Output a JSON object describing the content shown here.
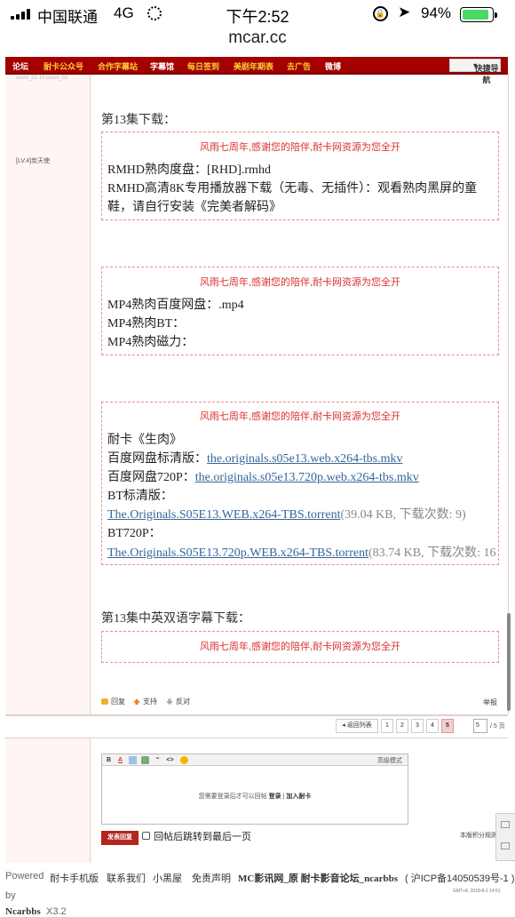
{
  "status_bar": {
    "carrier": "中国联通",
    "network": "4G",
    "time": "下午2:52",
    "battery": "94%"
  },
  "browser": {
    "url": "mcar.cc"
  },
  "topnav": {
    "items": [
      "论坛",
      "耐卡公众号",
      "合作字幕站",
      "字幕馆",
      "每日签到",
      "美剧年期表",
      "去广告",
      "微博"
    ],
    "quick_nav": "快捷导航"
  },
  "colors": {
    "nav_bg": "#a40000",
    "notice": "#dc3030",
    "link": "#336699",
    "accent_yellow": "#ffcc33"
  },
  "author": {
    "old_name": "ceshi_01.15.ceshi_02",
    "level": "[LV.4]炭天使"
  },
  "post": {
    "episode_heading": "第13集下载：",
    "notice": "风雨七周年,感谢您的陪伴,耐卡网资源为您全开",
    "rmhd": {
      "line1": "RMHD熟肉度盘：[RHD].rmhd",
      "line2": "RMHD高清8K专用播放器下载（无毒、无插件）：观看熟肉黑屏的童",
      "line3": "鞋，请自行安装《完美者解码》"
    },
    "mp4": {
      "line1": "MP4熟肉百度网盘：.mp4",
      "line2": "MP4熟肉BT：",
      "line3": "MP4熟肉磁力："
    },
    "raw": {
      "title": "耐卡《生肉》",
      "baidu_std_label": "百度网盘标清版：",
      "baidu_std_link": "the.originals.s05e13.web.x264-tbs.mkv",
      "baidu_720_label": "百度网盘720P：",
      "baidu_720_link": "the.originals.s05e13.720p.web.x264-tbs.mkv",
      "bt_std_label": "BT标清版：",
      "bt_std_link": "The.Originals.S05E13.WEB.x264-TBS.torrent",
      "bt_std_meta": "(39.04 KB, 下载次数: 9)",
      "bt_720_label": "BT720P：",
      "bt_720_link": "The.Originals.S05E13.720p.WEB.x264-TBS.torrent",
      "bt_720_meta": "(83.74 KB, 下载次数: 16"
    },
    "subtitle_heading": "第13集中英双语字幕下载："
  },
  "actions": {
    "reply": "回复",
    "support": "支持",
    "oppose": "反对",
    "report": "举报"
  },
  "pager": {
    "back": "返回列表",
    "pages": [
      "1",
      "2",
      "3",
      "4",
      "5"
    ],
    "current": "5",
    "input_value": "5",
    "total": "/ 5 页"
  },
  "reply_editor": {
    "advanced": "高级模式",
    "login_prompt": "您需要登录后才可以回帖",
    "login": "登录",
    "register": "加入耐卡",
    "submit": "发表回复",
    "jump_label": "回帖后跳转到最后一页",
    "rules": "本版积分规则"
  },
  "footer": {
    "powered": "Powered",
    "by": "by",
    "brand": "Ncarbbs",
    "version": "X3.2",
    "links": [
      "耐卡手机版",
      "联系我们",
      "小黑屋",
      "免责声明"
    ],
    "site": "MC影讯网_原 耐卡影音论坛_ncarbbs",
    "icp": "( 沪ICP备14050539号-1 )",
    "gmt": "GMT+8, 2018-8-2 14:51"
  }
}
